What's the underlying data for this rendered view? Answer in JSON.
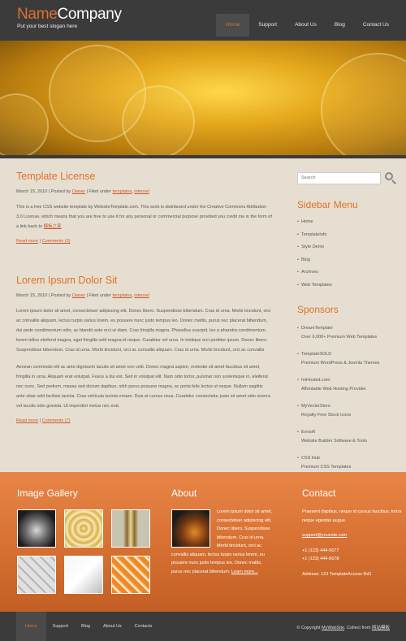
{
  "header": {
    "logo_name": "Name",
    "logo_company": "Company",
    "slogan": "Put your best slogan here",
    "nav": [
      "Home",
      "Support",
      "About Us",
      "Blog",
      "Contact Us"
    ]
  },
  "posts": [
    {
      "title": "Template License",
      "date": "March 15, 2010",
      "posted_by_label": "Posted by",
      "author": "Owner",
      "filed_label": "Filed under",
      "cat1": "templates",
      "cat2": "internet",
      "body1": "This is a free CSS website template by WebsiteTemplate.com. This work is distributed under the Creative Commons Attribution 3.0 License, which means that you are free to use it for any personal or commercial purpose provided you credit me in the form of a link back to",
      "body1_link": "模板之家",
      "body2": "",
      "read_more": "Read more",
      "comments": "Comments (3)"
    },
    {
      "title": "Lorem Ipsum Dolor Sit",
      "date": "March 15, 2010",
      "posted_by_label": "Posted by",
      "author": "Owner",
      "filed_label": "Filed under",
      "cat1": "templates",
      "cat2": "internet",
      "body1": "Lorem ipsum dolor sit amet, consectetuer adipiscing elit. Donec libero. Suspendisse bibendum. Cras id urna. Morbi tincidunt, orci ac convallis aliquam, lectus turpis varius lorem, eu posuere nunc justo tempus leo. Donec mattis, purus nec placerat bibendum, dui pede condimentum odio, ac blandit ante orci ut diam. Cras fringilla magna. Phasellus suscipit, leo a pharetra condimentum, lorem tellus eleifend magna, eget fringilla velit magna id neque. Curabitur vel urna. In tristique orci porttitor ipsum. Donec libero. Suspendisse bibendum. Cras id urna. Morbi tincidunt, orci ac convallis aliquam. Cras id urna. Morbi tincidunt, orci ac convallis aliquam, lectus turpis varius lorem, eu posuere nunc justo tempus leo. Donec mattis, purus nec placerat bibendum, dui pede condimentum odio, ac blandit ante orci ut diam. Cras fringilla magna. Phasellus suscipit, leo a pharetra condimentum, lorem tellus eleifend magna, eget fringilla velit magna id neque. Curabitur vel urna. In tristique orci porttitor ipsum.",
      "body1_link": "",
      "body2": "Aenean commodo elit ac ante dignissim iaculis sit amet non velit. Donec magna sapien, molestie sit amet faucibus sit amet, fringilla in urna. Aliquam erat volutpat. Fusce a dui est. Sed in volutpat elit. Nam odio tortor, pulvinar non scelerisque in, eleifend nec nunc. Sed pretium, massa sed dictum dapibus, nibh purus posuere magna, ac porta felis lectus ut neque. Nullam sagittis ante vitae velit facilisis lacinia. Cras vehicula lacinia ornare. Duis et cursus risus. Curabitur consectetur justo sit amet odio viverra vel iaculis odio gravida. Ut imperdiet metus nec erat.",
      "read_more": "Read more",
      "comments": "Comments (7)"
    }
  ],
  "sidebar": {
    "search_placeholder": "Search",
    "menu_title": "Sidebar Menu",
    "menu": [
      "Home",
      "TemplateInfo",
      "Style Demo",
      "Blog",
      "Archives",
      "Web Templates"
    ],
    "sponsors_title": "Sponsors",
    "sponsors": [
      {
        "name": "DreamTemplate",
        "desc": "Over 6,000+ Premium Web Templates"
      },
      {
        "name": "TemplateSOLD",
        "desc": "Premium WordPress & Joomla Themes"
      },
      {
        "name": "ImHosted.com",
        "desc": "Affordable Web Hosting Provider"
      },
      {
        "name": "MyVectorStore",
        "desc": "Royalty Free Stock Icons"
      },
      {
        "name": "Evrsoft",
        "desc": "Website Builder Software & Tools"
      },
      {
        "name": "CSS Hub",
        "desc": "Premium CSS Templates"
      }
    ]
  },
  "footer": {
    "gallery_title": "Image Gallery",
    "about_title": "About",
    "about_text": "Lorem ipsum dolor sit amet, consectetuer adipiscing elit. Donec libero. Suspendisse bibendum. Cras id urna. Morbi tincidunt, orci ac convallis aliquam, lectus turpis varius lorem, eu posuere nunc justo tempus leo. Donec mattis, purus nec placerat bibendum.",
    "about_more": "Learn more...",
    "contact_title": "Contact",
    "contact_text": "Praesent dapibus, neque id cursus faucibus, tortor neque egestas augue.",
    "contact_email": "support@yoursite.com",
    "phone1": "+1 (123) 444-5677",
    "phone2": "+1 (123) 444-5678",
    "address": "Address: 123 TemplateAccess Rd1"
  },
  "bottom": {
    "nav": [
      "Home",
      "Support",
      "Blog",
      "About Us",
      "Contacts"
    ],
    "copyright_prefix": "© Copyright",
    "copyright_site": "MyWebSite",
    "copyright_mid": ". Collect from",
    "copyright_link": "网站模板"
  }
}
